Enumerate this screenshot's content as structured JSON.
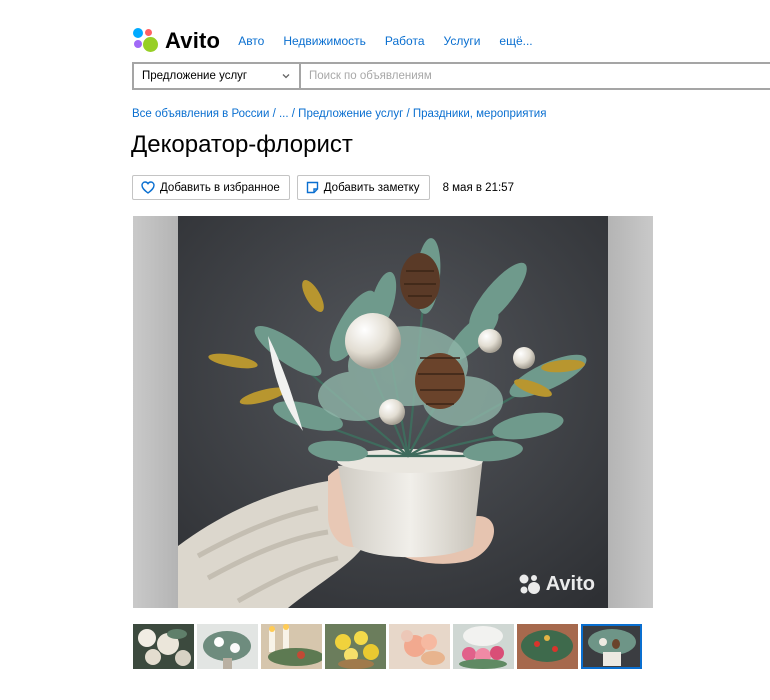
{
  "header": {
    "logo_text": "Avito",
    "logo_dot_colors": [
      "#00aaff",
      "#97cf26",
      "#ff6163",
      "#a169f7"
    ],
    "nav": [
      "Авто",
      "Недвижимость",
      "Работа",
      "Услуги",
      "ещё..."
    ]
  },
  "search": {
    "category": "Предложение услуг",
    "placeholder": "Поиск по объявлениям"
  },
  "breadcrumbs": [
    "Все объявления в России",
    "...",
    "Предложение услуг",
    "Праздники, мероприятия"
  ],
  "listing": {
    "title": "Декоратор-флорист",
    "favorite_label": "Добавить в избранное",
    "note_label": "Добавить заметку",
    "date": "8 мая в 21:57"
  },
  "gallery": {
    "watermark_text": "Avito",
    "thumbnail_count": 8,
    "selected_index": 7
  },
  "colors": {
    "link": "#0a6fd0",
    "border": "#a5a5a5"
  }
}
